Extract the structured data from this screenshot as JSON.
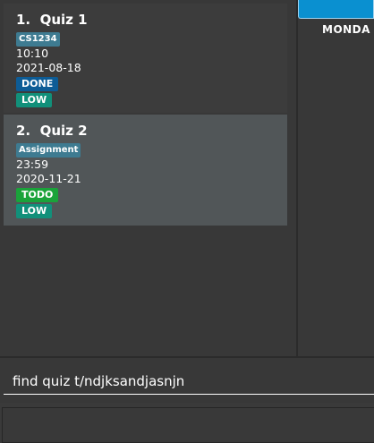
{
  "tasks": [
    {
      "index": "1.",
      "title": "Quiz 1",
      "tag": "CS1234",
      "time": "10:10",
      "date": "2021-08-18",
      "status": "DONE",
      "priority": "LOW"
    },
    {
      "index": "2.",
      "title": "Quiz 2",
      "tag": "Assignment",
      "time": "23:59",
      "date": "2020-11-21",
      "status": "TODO",
      "priority": "LOW"
    }
  ],
  "calendar": {
    "day_label": "MONDA"
  },
  "command": {
    "value": "find quiz t/ndjksandjasnjn"
  },
  "colors": {
    "tag": "#3e7b91",
    "status_done": "#0d5c96",
    "status_todo": "#1aa33a",
    "priority_low": "#11907a",
    "selected_card": "#515658",
    "calendar_header": "#0a90d0"
  }
}
